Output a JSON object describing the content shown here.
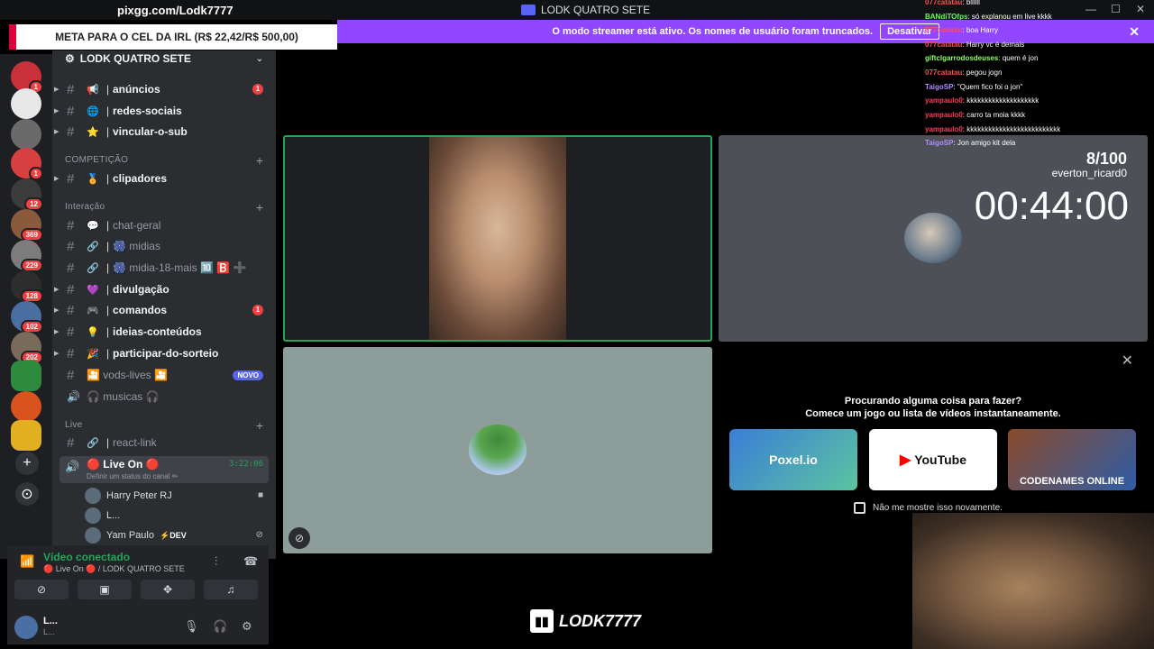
{
  "stream": {
    "url": "pixgg.com/Lodk7777",
    "goal": "META PARA O CEL DA IRL (R$ 22,42/R$ 500,00)",
    "brand": "LODK7777"
  },
  "window": {
    "title": "LODK QUATRO SETE",
    "minimize": "—",
    "maximize": "☐",
    "close": "✕"
  },
  "banner": {
    "text": "O modo streamer está ativo. Os nomes de usuário foram truncados.",
    "button": "Desativar",
    "close": "✕"
  },
  "rail": {
    "badges": [
      "1",
      "",
      "",
      "1",
      "12",
      "369",
      "229",
      "128",
      "102",
      "202"
    ],
    "add": "+",
    "discover": "⊙"
  },
  "server": {
    "name": "LODK QUATRO SETE",
    "chevron": "⌄"
  },
  "channels": [
    {
      "emoji": "📢",
      "label": "anúncios",
      "badge": "1"
    },
    {
      "emoji": "🌐",
      "label": "redes-sociais"
    },
    {
      "emoji": "⭐",
      "label": "vincular-o-sub"
    },
    {
      "emoji": "🏅",
      "label": "clipadores"
    },
    {
      "emoji": "💬",
      "label": "chat-geral"
    },
    {
      "emoji": "🔗",
      "label": "🎆 midias"
    },
    {
      "emoji": "🔗",
      "label": "🎆 midia-18-mais 🔟 🅱️ ➕"
    },
    {
      "emoji": "💜",
      "label": "divulgação"
    },
    {
      "emoji": "🎮",
      "label": "comandos",
      "badge": "1"
    },
    {
      "emoji": "💡",
      "label": "ideias-conteúdos"
    },
    {
      "emoji": "🎉",
      "label": "participar-do-sorteio"
    },
    {
      "emoji": "",
      "label": "🎦 vods-lives 🎦",
      "badge": "NOVO"
    },
    {
      "emoji": "🔊",
      "label": "🎧 musicas 🎧"
    },
    {
      "emoji": "🔗",
      "label": "react-link"
    }
  ],
  "categories": {
    "comp": "COMPETIÇÃO",
    "inter": "Interação",
    "live": "Live"
  },
  "voice": {
    "name": "🔴 Live On 🔴",
    "status": "Definir um status do canal ✏",
    "time": "3:22:06",
    "members": [
      "Harry Peter RJ",
      "L...",
      "Yam Paulo"
    ],
    "dev": "⚡DEV"
  },
  "connection": {
    "title": "Vídeo conectado",
    "sub": "🔴 Live On 🔴 / LODK QUATRO SETE"
  },
  "user": {
    "name": "L...",
    "tag": "L..."
  },
  "tiles": {
    "counter": "8/100",
    "counter_user": "everton_ricard0",
    "timer": "00:44:00"
  },
  "activity": {
    "line1": "Procurando alguma coisa para fazer?",
    "line2": "Comece um jogo ou lista de vídeos instantaneamente.",
    "cards": [
      "Poxel.io",
      "YouTube",
      "CODENAMES ONLINE"
    ],
    "checkbox": "Não me mostre isso novamente."
  },
  "chat": [
    {
      "user": "077catatau",
      "color": "#ff4d4d",
      "text": "bllllll"
    },
    {
      "user": "BANdiTOfps",
      "color": "#5cff5c",
      "text": "só explanou em live kkkk"
    },
    {
      "user": "077catatau",
      "color": "#ff4d4d",
      "text": "boa Harry"
    },
    {
      "user": "077catatau",
      "color": "#ff4d4d",
      "text": "Harry vc é demais"
    },
    {
      "user": "giftclgarrodosdeuses",
      "color": "#8cff5c",
      "text": "quem é jon"
    },
    {
      "user": "077catatau",
      "color": "#ff4d4d",
      "text": "pegou jogn"
    },
    {
      "user": "TaigoSP",
      "color": "#b48cff",
      "text": "\"Quem fico foi o jon\""
    },
    {
      "user": "yampaulo0",
      "color": "#ff3b5c",
      "text": "kkkkkkkkkkkkkkkkkkkk"
    },
    {
      "user": "yampaulo0",
      "color": "#ff3b5c",
      "text": "carro ta moia kkkk"
    },
    {
      "user": "yampaulo0",
      "color": "#ff3b5c",
      "text": "kkkkkkkkkkkkkkkkkkkkkkkkkk"
    },
    {
      "user": "TaigoSP",
      "color": "#b48cff",
      "text": "Jon amigo kit dela"
    }
  ]
}
